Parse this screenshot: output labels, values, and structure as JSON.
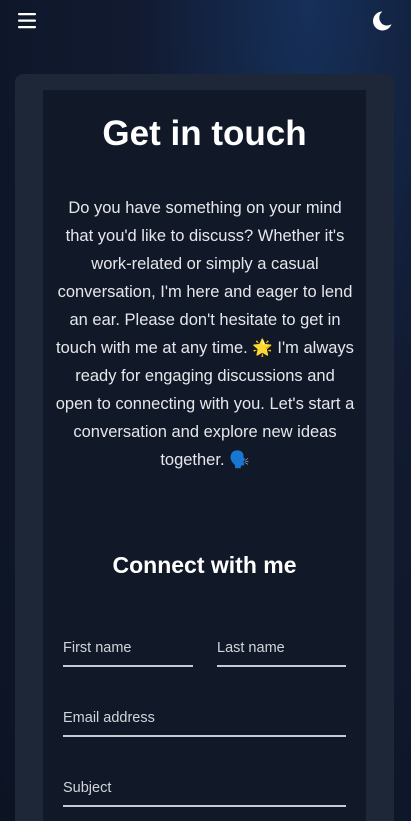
{
  "header": {
    "menu_icon": "hamburger-menu-icon",
    "theme_icon": "moon-icon"
  },
  "contact": {
    "title": "Get in touch",
    "intro": "Do you have something on your mind that you'd like to discuss? Whether it's work-related or simply a casual conversation, I'm here and eager to lend an ear. Please don't hesitate to get in touch with me at any time. 🌟 I'm always ready for engaging discussions and open to connecting with you. Let's start a conversation and explore new ideas together. 🗣️",
    "form_title": "Connect with me"
  },
  "form": {
    "first_name_placeholder": "First name",
    "last_name_placeholder": "Last name",
    "email_placeholder": "Email address",
    "subject_placeholder": "Subject"
  },
  "colors": {
    "background": "#0c1424",
    "outer_card": "#1d2738",
    "inner_card": "#111827",
    "field_underline": "#c5cad4"
  }
}
